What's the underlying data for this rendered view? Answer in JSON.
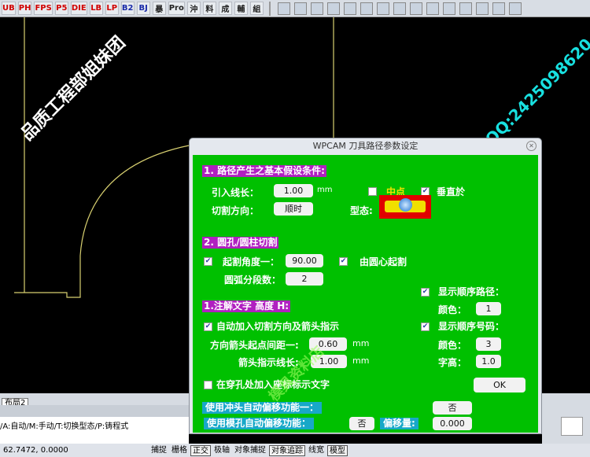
{
  "toolbar": {
    "left": [
      {
        "t": "UB",
        "c": "red"
      },
      {
        "t": "PH",
        "c": "red"
      },
      {
        "t": "FPS",
        "c": "red"
      },
      {
        "t": "P5",
        "c": "red"
      },
      {
        "t": "DIE",
        "c": "red"
      },
      {
        "t": "LB",
        "c": "red"
      },
      {
        "t": "LP",
        "c": "red"
      },
      {
        "t": "B2",
        "c": "blue"
      },
      {
        "t": "BJ",
        "c": "blue"
      },
      {
        "t": "暴",
        "c": "blk"
      },
      {
        "t": "Pro",
        "c": "blk"
      },
      {
        "t": "沖",
        "c": "blk"
      },
      {
        "t": "料",
        "c": "blk"
      },
      {
        "t": "成",
        "c": "blk"
      },
      {
        "t": "輔",
        "c": "blk"
      },
      {
        "t": "組",
        "c": "blk"
      }
    ]
  },
  "watermarks": {
    "a": "品质工程部姐妹团",
    "b": "QQ:2425098620",
    "c": "模具资料店"
  },
  "dialog": {
    "title": "WPCAM 刀具路径参数设定",
    "s1": {
      "header": "1. 路径产生之基本假设条件:",
      "leadin_label": "引入线长：",
      "leadin_value": "1.00",
      "leadin_unit": "mm",
      "midpoint_label": "中点",
      "perp_label": "垂直於",
      "dir_label": "切割方向：",
      "dir_value": "顺时",
      "type_label": "型态:"
    },
    "s2": {
      "header": "2. 圆孔/圆柱切割",
      "angle_label": "起割角度一：",
      "angle_value": "90.00",
      "center_label": "由圆心起割",
      "seg_label": "圆弧分段数：",
      "seg_value": "2"
    },
    "right": {
      "show_path_label": "显示顺序路径：",
      "color1_label": "颜色：",
      "color1_value": "1",
      "show_num_label": "显示顺序号码：",
      "color2_label": "颜色：",
      "color2_value": "3",
      "height_label": "字高：",
      "height_value": "1.0"
    },
    "s3": {
      "header": "1.注解文字 高度 H:",
      "auto_label": "自动加入切割方向及箭头指示",
      "gap_label": "方向箭头起点间距一:",
      "gap_value": "0.60",
      "gap_unit": "mm",
      "len_label": "箭头指示线长:",
      "len_value": "1.00",
      "len_unit": "mm",
      "coord_label": "在穿孔处加入座标标示文字"
    },
    "ok": "OK",
    "punch_label": "使用冲头自动偏移功能一：",
    "punch_value": "否",
    "die_label": "使用模孔自动偏移功能：",
    "die_value": "否",
    "offset_label": "偏移量:",
    "offset_value": "0.000"
  },
  "layout_tab": "布局2",
  "command_line": "/A:自动/M:手动/T:切换型态/P:铸程式",
  "coordinates": "62.7472, 0.0000",
  "status_buttons": [
    {
      "t": "捕捉",
      "on": false
    },
    {
      "t": "栅格",
      "on": false
    },
    {
      "t": "正交",
      "on": true
    },
    {
      "t": "极轴",
      "on": false
    },
    {
      "t": "对象捕捉",
      "on": false
    },
    {
      "t": "对象追踪",
      "on": true
    },
    {
      "t": "线宽",
      "on": false
    },
    {
      "t": "模型",
      "on": true
    }
  ]
}
